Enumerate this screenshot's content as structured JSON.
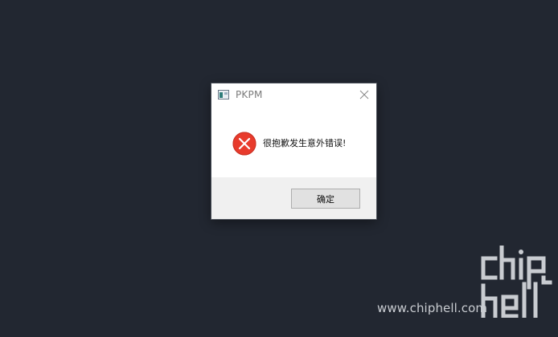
{
  "dialog": {
    "title": "PKPM",
    "message": "很抱歉发生意外错误!",
    "ok_label": "确定",
    "icons": {
      "app": "app-icon",
      "close": "close-icon",
      "status": "error-icon"
    }
  },
  "watermark": {
    "text": "www.chiphell.com",
    "logo": "chiphell-logo"
  },
  "colors": {
    "desktop_background": "#222731",
    "error_red": "#e83b2c",
    "button_face": "#e1e1e1",
    "footer_background": "#f0f0f0"
  }
}
